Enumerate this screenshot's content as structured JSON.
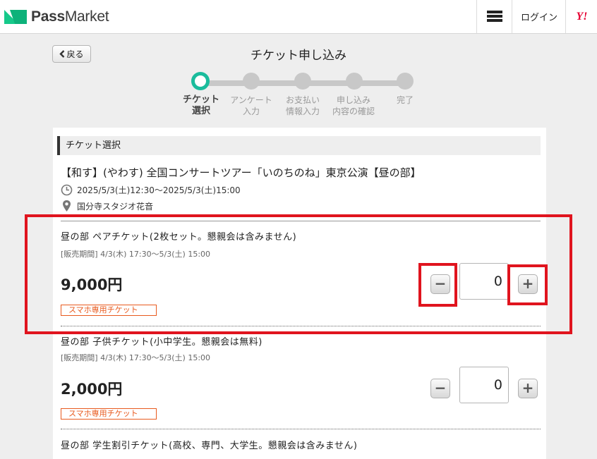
{
  "header": {
    "logo_text_bold": "Pass",
    "logo_text": "Market",
    "login_label": "ログイン",
    "yahoo_label": "Y!"
  },
  "nav": {
    "back_label": "戻る",
    "page_title": "チケット申し込み"
  },
  "steps": [
    {
      "label": "チケット\n選択",
      "active": true
    },
    {
      "label": "アンケート\n入力",
      "active": false
    },
    {
      "label": "お支払い\n情報入力",
      "active": false
    },
    {
      "label": "申し込み\n内容の確認",
      "active": false
    },
    {
      "label": "完了",
      "active": false
    }
  ],
  "section": {
    "heading": "チケット選択"
  },
  "event": {
    "title": "【和す】(やわす) 全国コンサートツアー「いのちのね」東京公演【昼の部】",
    "datetime": "2025/5/3(土)12:30〜2025/5/3(土)15:00",
    "venue": "国分寺スタジオ花音"
  },
  "tickets": [
    {
      "name": "昼の部 ペアチケット(2枚セット。懇親会は含みません)",
      "period": "[販売期間] 4/3(木) 17:30〜5/3(土) 15:00",
      "price": "9,000円",
      "badge": "スマホ専用チケット",
      "quantity": "0"
    },
    {
      "name": "昼の部 子供チケット(小中学生。懇親会は無料)",
      "period": "[販売期間] 4/3(木) 17:30〜5/3(土) 15:00",
      "price": "2,000円",
      "badge": "スマホ専用チケット",
      "quantity": "0"
    },
    {
      "name": "昼の部 学生割引チケット(高校、専門、大学生。懇親会は含みません)"
    }
  ],
  "icons": {
    "minus": "−",
    "plus": "+"
  },
  "colors": {
    "brand": "#16c98a",
    "step_active": "#1abc9c",
    "badge": "#e85a1e",
    "highlight": "#e0141e"
  }
}
